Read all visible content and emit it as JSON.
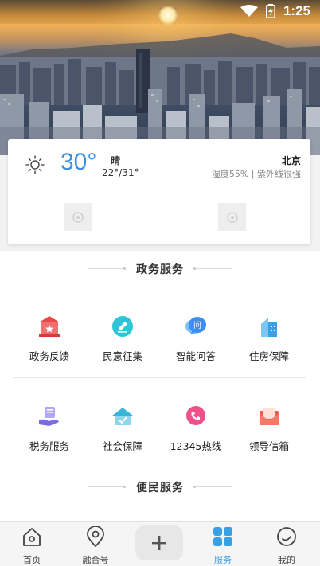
{
  "status_bar": {
    "time": "1:25"
  },
  "weather": {
    "temperature": "30°",
    "condition": "晴",
    "range": "22°/31°",
    "city": "北京",
    "details": "湿度55% | 紫外线很强"
  },
  "sections": {
    "government": {
      "title": "政务服务",
      "items": [
        {
          "label": "政务反馈",
          "icon": "government-building-icon",
          "color": "#e84a4a"
        },
        {
          "label": "民意征集",
          "icon": "pen-edit-icon",
          "color": "#2ec6d6"
        },
        {
          "label": "智能问答",
          "icon": "chat-question-icon",
          "color": "#3b8ff0"
        },
        {
          "label": "住房保障",
          "icon": "housing-building-icon",
          "color": "#3aa0e6"
        },
        {
          "label": "税务服务",
          "icon": "tax-hand-icon",
          "color": "#7b6be8"
        },
        {
          "label": "社会保障",
          "icon": "social-security-house-icon",
          "color": "#38b6d8"
        },
        {
          "label": "12345热线",
          "icon": "phone-hotline-icon",
          "color": "#f0508a"
        },
        {
          "label": "领导信箱",
          "icon": "mailbox-icon",
          "color": "#f05a4a"
        }
      ]
    },
    "convenience": {
      "title": "便民服务"
    }
  },
  "bottom_nav": {
    "items": [
      {
        "label": "首页",
        "icon": "home-icon"
      },
      {
        "label": "融合号",
        "icon": "location-pin-icon"
      },
      {
        "label": "服务",
        "icon": "grid-services-icon",
        "active": true
      },
      {
        "label": "我的",
        "icon": "profile-icon"
      }
    ],
    "plus": "+"
  },
  "colors": {
    "accent": "#3aa0e6",
    "temperature": "#3d8fe0"
  }
}
